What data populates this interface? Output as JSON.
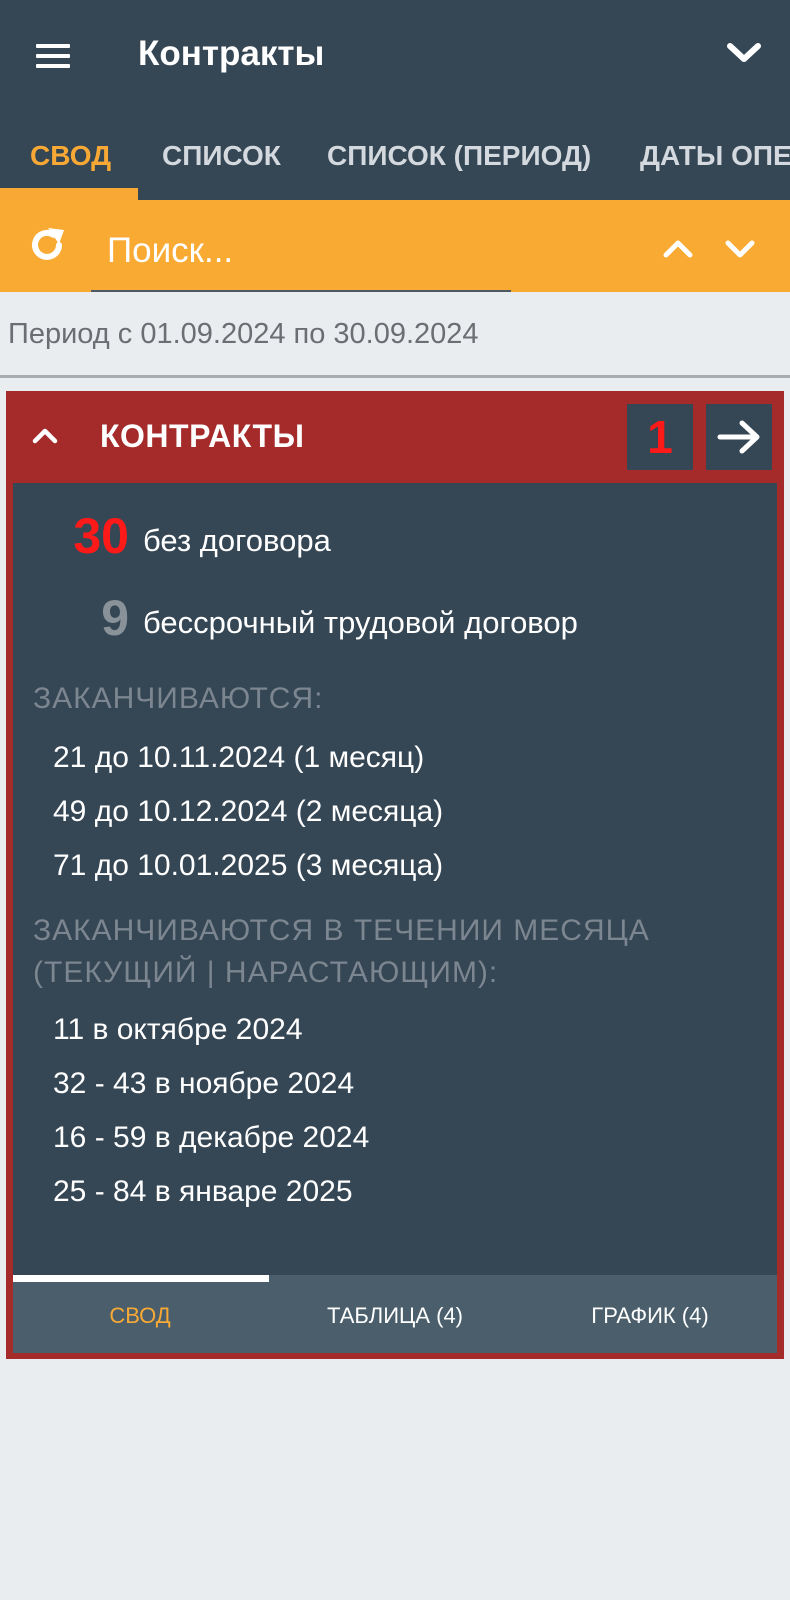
{
  "appbar": {
    "title": "Контракты",
    "menu_icon": "hamburger-menu-icon",
    "dropdown_icon": "chevron-down-icon"
  },
  "tabs": [
    {
      "label": "СВОД",
      "active": true
    },
    {
      "label": "СПИСОК",
      "active": false
    },
    {
      "label": "СПИСОК (ПЕРИОД)",
      "active": false
    },
    {
      "label": "ДАТЫ ОПЕ",
      "active": false
    }
  ],
  "search": {
    "placeholder": "Поиск...",
    "refresh_icon": "refresh-icon",
    "up_icon": "chevron-up-icon",
    "down_icon": "chevron-down-icon"
  },
  "period": "Период с 01.09.2024 по 30.09.2024",
  "card": {
    "title": "КОНТРАКТЫ",
    "badge": "1",
    "collapse_icon": "chevron-up-icon",
    "go_icon": "arrow-right-icon",
    "stats": [
      {
        "number": "30",
        "label": "без договора",
        "color": "#ff1a1a"
      },
      {
        "number": "9",
        "label": "бессрочный трудовой договор",
        "color": "#8a9299"
      }
    ],
    "ending_heading": "ЗАКАНЧИВАЮТСЯ:",
    "ending": [
      "21 до 10.11.2024 (1 месяц)",
      "49 до 10.12.2024 (2 месяца)",
      "71 до 10.01.2025 (3 месяца)"
    ],
    "monthly_heading_1": "ЗАКАНЧИВАЮТСЯ В ТЕЧЕНИИ МЕСЯЦА",
    "monthly_heading_2": "(ТЕКУЩИЙ | НАРАСТАЮЩИМ):",
    "monthly": [
      "11 в октябре 2024",
      "32 - 43 в ноябре 2024",
      "16 - 59 в декабре 2024",
      "25 - 84 в январе 2025"
    ],
    "bottom_tabs": [
      {
        "label": "СВОД",
        "active": true
      },
      {
        "label": "ТАБЛИЦА (4)",
        "active": false
      },
      {
        "label": "ГРАФИК (4)",
        "active": false
      }
    ]
  },
  "colors": {
    "appbar": "#354654",
    "accent_orange": "#f8a935",
    "card_red": "#a52a2a",
    "stat_red": "#ff1a1a"
  }
}
